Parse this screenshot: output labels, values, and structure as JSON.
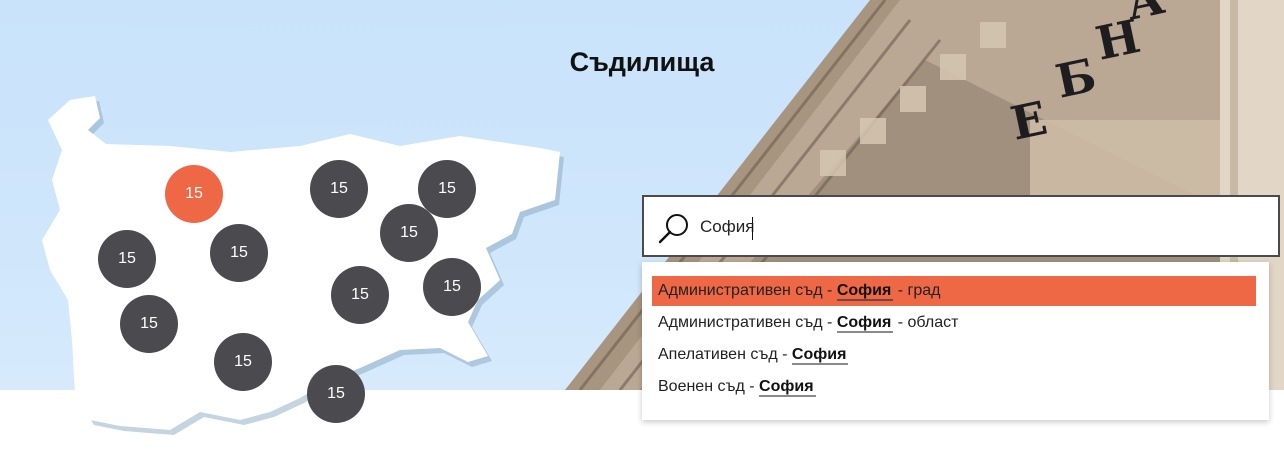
{
  "page": {
    "title": "Съдилища"
  },
  "search": {
    "value": "София",
    "placeholder": ""
  },
  "map": {
    "markers": [
      {
        "count": "15",
        "active": true
      },
      {
        "count": "15"
      },
      {
        "count": "15"
      },
      {
        "count": "15"
      },
      {
        "count": "15"
      },
      {
        "count": "15"
      },
      {
        "count": "15"
      },
      {
        "count": "15"
      },
      {
        "count": "15"
      },
      {
        "count": "15"
      },
      {
        "count": "15"
      },
      {
        "count": "15"
      }
    ]
  },
  "suggestions": [
    {
      "prefix": "Административен съд - ",
      "match": "София",
      "suffix": " - град",
      "active": true
    },
    {
      "prefix": "Административен съд - ",
      "match": "София",
      "suffix": " - област"
    },
    {
      "prefix": "Апелативен съд - ",
      "match": "София",
      "suffix": ""
    },
    {
      "prefix": "Военен съд - ",
      "match": "София",
      "suffix": ""
    }
  ],
  "colors": {
    "accent": "#ef6846",
    "marker": "#4b4b4f",
    "sky": "#cfe6fb",
    "map_fill": "#ffffff"
  },
  "icons": {
    "search": "search-icon"
  }
}
